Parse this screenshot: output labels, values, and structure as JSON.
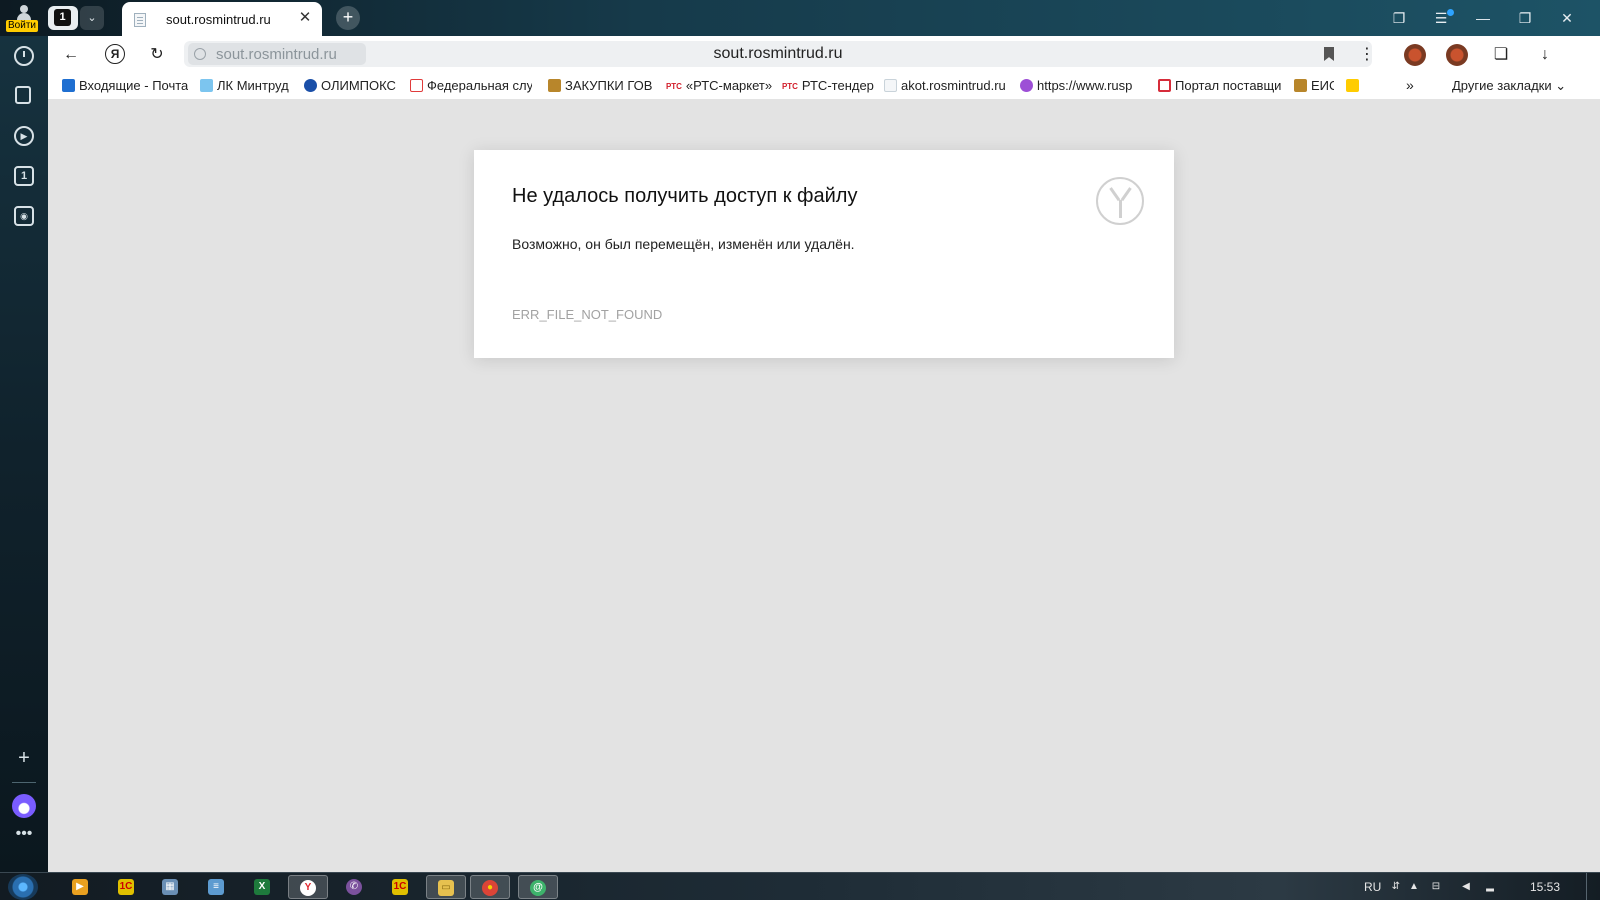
{
  "window": {
    "login_label": "Войти",
    "tab_count": "1",
    "active_tab_title": "sout.rosmintrud.ru",
    "close_glyph": "✕",
    "new_tab_glyph": "+"
  },
  "toolbar": {
    "back_glyph": "←",
    "yandex_glyph": "Я",
    "reload_glyph": "↻",
    "address_chip": "sout.rosmintrud.ru",
    "address_title": "sout.rosmintrud.ru",
    "menu_glyph": "⋮",
    "download_glyph": "↓"
  },
  "bookmarks": {
    "items": [
      {
        "label": "Входящие - Почта",
        "icon": "mail-icon",
        "color": "#1f6fd1"
      },
      {
        "label": "ЛК Минтруд",
        "icon": "mintrud-icon",
        "color": "#7cc5ef"
      },
      {
        "label": "ОЛИМПОКС",
        "icon": "olimpoks-icon",
        "color": "#1a4fa8"
      },
      {
        "label": "Федеральная слу",
        "icon": "federal-service-icon",
        "color": "#e03b3b"
      },
      {
        "label": "ЗАКУПКИ ГОВ",
        "icon": "eagle-icon",
        "color": "#b8862b"
      },
      {
        "label": "«РТС-маркет»",
        "icon": "rts-icon",
        "badge": "РТС"
      },
      {
        "label": "РТС-тендер",
        "icon": "rts-icon",
        "badge": "РТС"
      },
      {
        "label": "akot.rosmintrud.ru",
        "icon": "page-icon",
        "color": "#c9d3da"
      },
      {
        "label": "https://www.rusp",
        "icon": "podcast-icon",
        "color": "#9d4fd6"
      },
      {
        "label": "Портал поставщи",
        "icon": "portal-icon",
        "color": "#d62c3a"
      },
      {
        "label": "ЕИС",
        "icon": "eagle-icon",
        "color": "#b8862b"
      }
    ],
    "more_glyph": "»",
    "other_label": "Другие закладки"
  },
  "error": {
    "title": "Не удалось получить доступ к файлу",
    "description": "Возможно, он был перемещён, изменён или удалён.",
    "code": "ERR_FILE_NOT_FOUND"
  },
  "taskbar": {
    "language": "RU",
    "time": "15:53",
    "apps": [
      {
        "name": "media-player-icon",
        "color": "#e8a020",
        "glyph": "▶"
      },
      {
        "name": "1c-icon",
        "color": "#e0c000",
        "glyph": "1С"
      },
      {
        "name": "calculator-icon",
        "color": "#6a8fb5",
        "glyph": "▦"
      },
      {
        "name": "notepad-icon",
        "color": "#5d9bd0",
        "glyph": "≡"
      },
      {
        "name": "excel-icon",
        "color": "#1e7a3c",
        "glyph": "X"
      },
      {
        "name": "yandex-browser-icon",
        "color": "#ffffff",
        "glyph": "Y"
      },
      {
        "name": "viber-icon",
        "color": "#7b519d",
        "glyph": "✆"
      },
      {
        "name": "1c-enterprise-icon",
        "color": "#e0c000",
        "glyph": "1С"
      },
      {
        "name": "file-explorer-icon",
        "color": "#e7c14f",
        "glyph": "▭"
      },
      {
        "name": "chrome-icon",
        "color": "#db4437",
        "glyph": "●"
      },
      {
        "name": "mail-agent-icon",
        "color": "#3db36b",
        "glyph": "@"
      }
    ]
  },
  "colors": {
    "page_bg": "#e3e3e3",
    "card_bg": "#ffffff",
    "error_code": "#a2a2a2",
    "login_badge": "#ffcc00"
  }
}
